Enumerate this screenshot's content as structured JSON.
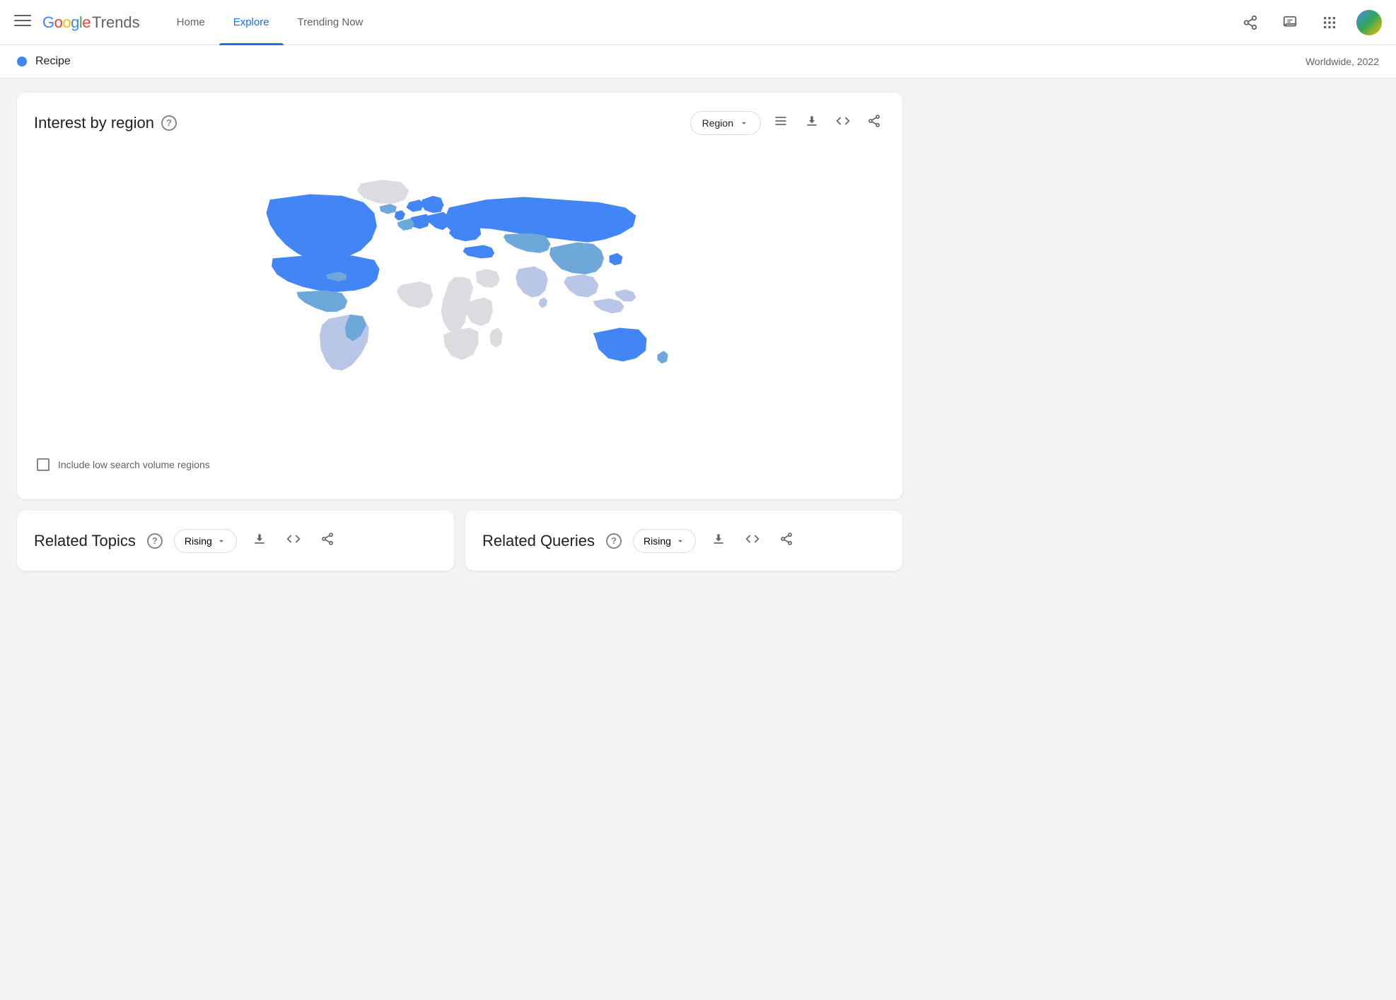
{
  "header": {
    "logo_google": "Google",
    "logo_trends": "Trends",
    "nav": [
      {
        "label": "Home",
        "active": false
      },
      {
        "label": "Explore",
        "active": true
      },
      {
        "label": "Trending Now",
        "active": false
      }
    ],
    "menu_icon": "☰"
  },
  "search_bar": {
    "term": "Recipe",
    "meta": "Worldwide, 2022"
  },
  "interest_by_region": {
    "title": "Interest by region",
    "region_btn": "Region",
    "include_low_volume": "Include low search volume regions"
  },
  "related_topics": {
    "title": "Related Topics",
    "dropdown_label": "Rising"
  },
  "related_queries": {
    "title": "Related Queries",
    "dropdown_label": "Rising"
  }
}
